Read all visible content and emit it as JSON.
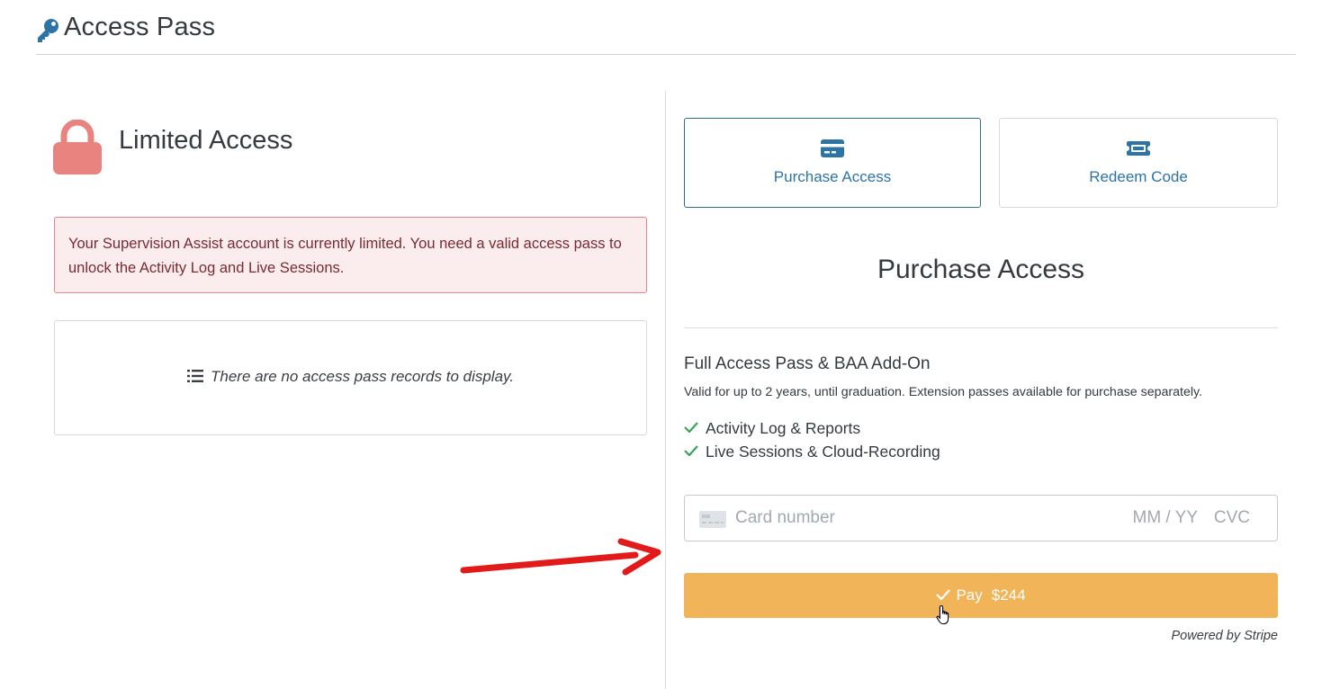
{
  "header": {
    "title": "Access Pass",
    "icon": "key-icon"
  },
  "left": {
    "title": "Limited Access",
    "lock_icon": "lock-icon",
    "alert_text": "Your Supervision Assist account is currently limited. You need a valid access pass to unlock the Activity Log and Live Sessions.",
    "empty_text": "There are no access pass records to display."
  },
  "tabs": [
    {
      "label": "Purchase Access",
      "icon": "credit-card-icon",
      "active": true
    },
    {
      "label": "Redeem Code",
      "icon": "ticket-icon",
      "active": false
    }
  ],
  "purchase": {
    "heading": "Purchase Access",
    "pass_name": "Full Access Pass & BAA Add-On",
    "pass_desc": "Valid for up to 2 years, until graduation. Extension passes available for purchase separately.",
    "features": [
      "Activity Log & Reports",
      "Live Sessions & Cloud-Recording"
    ],
    "card_placeholder": "Card number",
    "exp_placeholder": "MM / YY",
    "cvc_placeholder": "CVC",
    "pay_label": "Pay",
    "pay_amount": "$244",
    "powered_by": "Powered by Stripe"
  },
  "colors": {
    "accent_blue": "#2d74a6",
    "pay_button": "#f1b458",
    "alert_bg": "#fbecee",
    "alert_border": "#e0868d",
    "lock": "#e9837f",
    "check": "#3aa35a",
    "arrow": "#e21a1a"
  }
}
